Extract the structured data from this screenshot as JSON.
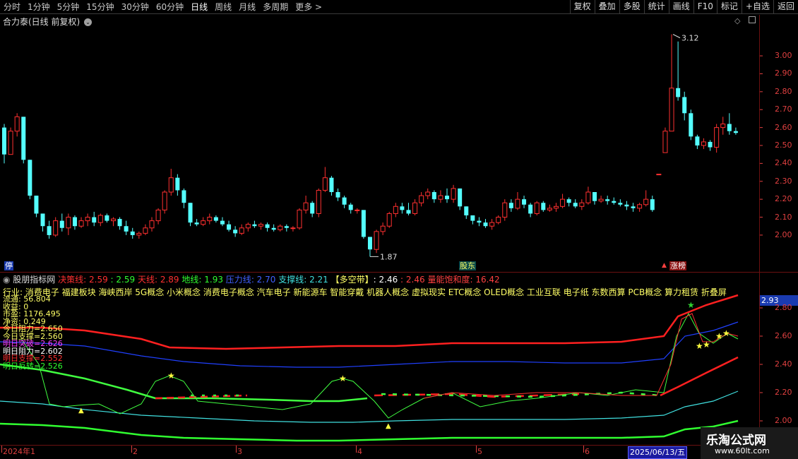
{
  "toolbar": {
    "periods": [
      "分时",
      "1分钟",
      "5分钟",
      "15分钟",
      "30分钟",
      "60分钟",
      "日线",
      "周线",
      "月线",
      "多周期",
      "更多 >"
    ],
    "active_period": "日线",
    "buttons": [
      "复权",
      "叠加",
      "多股",
      "统计",
      "画线",
      "F10",
      "标记",
      "+自选",
      "返回"
    ]
  },
  "stock": {
    "title": "合力泰(日线 前复权)",
    "high_label": "3.12",
    "low_label": "1.87",
    "y_labels": [
      "3.00",
      "2.90",
      "2.80",
      "2.70",
      "2.60",
      "2.50",
      "2.40",
      "2.30",
      "2.20",
      "2.10",
      "2.00"
    ],
    "tags": [
      "停",
      "股东",
      "涨榜"
    ]
  },
  "indicator": {
    "name": "股朋指标网",
    "lines": [
      {
        "label": "决策线",
        "value": "2.59",
        "extra": "2.59",
        "color": "#ff3030"
      },
      {
        "label": "天线",
        "value": "2.89",
        "color": "#ff3030"
      },
      {
        "label": "地线",
        "value": "1.93",
        "color": "#30ff30"
      },
      {
        "label": "压力线",
        "value": "2.70",
        "color": "#4060ff"
      },
      {
        "label": "支撑线",
        "value": "2.21",
        "color": "#40e0e0"
      }
    ],
    "band_label": "【多空带】",
    "band_values": [
      "2.46",
      "2.46"
    ],
    "volume_label": "量能饱和度",
    "volume_value": "16.42",
    "industry": "行业: 消费电子  福建板块  海峡西岸 5G概念 小米概念 消费电子概念 汽车电子 新能源车 智能穿戴 机器人概念 虚拟现实 ETC概念 OLED概念 工业互联 电子纸 东数西算 PCB概念 算力租赁 折叠屏",
    "info": [
      {
        "text": "流通: 56.804",
        "color": "#ffff66"
      },
      {
        "text": "收益: 0",
        "color": "#ffff66"
      },
      {
        "text": "市盈: 1176.495",
        "color": "#ffff66"
      },
      {
        "text": "净资: 0.249",
        "color": "#ffff66"
      },
      {
        "text": "今日阻力=2.650",
        "color": "#ffff66"
      },
      {
        "text": "今日支撑=2.560",
        "color": "#ffff66"
      },
      {
        "text": "明日突破=2.626",
        "color": "#ff40ff"
      },
      {
        "text": "明日阻力=2.602",
        "color": "#ffffff"
      },
      {
        "text": "明日支撑=2.552",
        "color": "#ff3030"
      },
      {
        "text": "明日反转=2.526",
        "color": "#30ff30"
      }
    ],
    "current_value": "2.93",
    "y_labels": [
      "2.80",
      "2.60",
      "2.40",
      "2.20",
      "2.00"
    ]
  },
  "date_axis": {
    "ticks": [
      "2024年1",
      "2",
      "3",
      "4",
      "5",
      "6"
    ],
    "selected_date": "2025/06/13/五"
  },
  "watermark": {
    "title": "乐淘公式网",
    "url": "www.60lt.com"
  },
  "chart_data": {
    "type": "candlestick",
    "up_color": "#ff3030",
    "down_color": "#54ffff",
    "ylim": [
      1.85,
      3.15
    ],
    "candles": [
      [
        2.6,
        2.62,
        2.4,
        2.45
      ],
      [
        2.45,
        2.6,
        2.45,
        2.58
      ],
      [
        2.58,
        2.68,
        2.55,
        2.66
      ],
      [
        2.66,
        2.66,
        2.4,
        2.42
      ],
      [
        2.42,
        2.42,
        2.2,
        2.22
      ],
      [
        2.22,
        2.22,
        2.1,
        2.12
      ],
      [
        2.12,
        2.12,
        2.02,
        2.05
      ],
      [
        2.05,
        2.08,
        1.98,
        2.0
      ],
      [
        2.0,
        2.1,
        1.99,
        2.08
      ],
      [
        2.08,
        2.12,
        2.02,
        2.04
      ],
      [
        2.04,
        2.12,
        2.0,
        2.1
      ],
      [
        2.1,
        2.11,
        2.03,
        2.05
      ],
      [
        2.05,
        2.1,
        2.04,
        2.08
      ],
      [
        2.08,
        2.12,
        2.05,
        2.1
      ],
      [
        2.1,
        2.13,
        2.05,
        2.07
      ],
      [
        2.07,
        2.12,
        2.05,
        2.11
      ],
      [
        2.11,
        2.12,
        2.07,
        2.08
      ],
      [
        2.08,
        2.1,
        2.05,
        2.09
      ],
      [
        2.09,
        2.1,
        2.03,
        2.05
      ],
      [
        2.05,
        2.08,
        2.0,
        2.02
      ],
      [
        2.02,
        2.04,
        1.98,
        2.0
      ],
      [
        2.0,
        2.02,
        1.98,
        2.01
      ],
      [
        2.01,
        2.06,
        2.0,
        2.04
      ],
      [
        2.04,
        2.1,
        2.02,
        2.08
      ],
      [
        2.08,
        2.15,
        2.06,
        2.14
      ],
      [
        2.14,
        2.25,
        2.12,
        2.24
      ],
      [
        2.24,
        2.37,
        2.22,
        2.32
      ],
      [
        2.32,
        2.34,
        2.22,
        2.25
      ],
      [
        2.25,
        2.26,
        2.15,
        2.18
      ],
      [
        2.18,
        2.18,
        2.05,
        2.07
      ],
      [
        2.07,
        2.09,
        2.05,
        2.06
      ],
      [
        2.06,
        2.1,
        2.05,
        2.08
      ],
      [
        2.08,
        2.12,
        2.06,
        2.1
      ],
      [
        2.1,
        2.11,
        2.07,
        2.08
      ],
      [
        2.08,
        2.1,
        2.05,
        2.06
      ],
      [
        2.06,
        2.08,
        2.02,
        2.03
      ],
      [
        2.03,
        2.05,
        1.99,
        2.01
      ],
      [
        2.01,
        2.06,
        2.0,
        2.04
      ],
      [
        2.04,
        2.07,
        2.02,
        2.06
      ],
      [
        2.06,
        2.08,
        2.04,
        2.05
      ],
      [
        2.05,
        2.07,
        2.03,
        2.06
      ],
      [
        2.06,
        2.07,
        2.02,
        2.04
      ],
      [
        2.04,
        2.06,
        2.02,
        2.03
      ],
      [
        2.03,
        2.06,
        2.02,
        2.05
      ],
      [
        2.05,
        2.06,
        2.02,
        2.04
      ],
      [
        2.04,
        2.05,
        2.02,
        2.04
      ],
      [
        2.04,
        2.15,
        2.03,
        2.14
      ],
      [
        2.14,
        2.22,
        2.12,
        2.18
      ],
      [
        2.18,
        2.19,
        2.1,
        2.12
      ],
      [
        2.12,
        2.26,
        2.1,
        2.25
      ],
      [
        2.25,
        2.38,
        2.24,
        2.32
      ],
      [
        2.32,
        2.33,
        2.22,
        2.24
      ],
      [
        2.24,
        2.26,
        2.19,
        2.21
      ],
      [
        2.21,
        2.22,
        2.15,
        2.17
      ],
      [
        2.17,
        2.18,
        2.12,
        2.14
      ],
      [
        2.14,
        2.15,
        2.12,
        2.14
      ],
      [
        2.14,
        2.14,
        1.98,
        1.99
      ],
      [
        1.99,
        1.99,
        1.88,
        1.92
      ],
      [
        1.92,
        2.03,
        1.9,
        2.02
      ],
      [
        2.02,
        2.07,
        2.0,
        2.05
      ],
      [
        2.05,
        2.13,
        2.04,
        2.12
      ],
      [
        2.12,
        2.18,
        2.1,
        2.16
      ],
      [
        2.16,
        2.18,
        2.12,
        2.14
      ],
      [
        2.14,
        2.18,
        2.11,
        2.12
      ],
      [
        2.12,
        2.2,
        2.11,
        2.18
      ],
      [
        2.18,
        2.24,
        2.16,
        2.22
      ],
      [
        2.22,
        2.26,
        2.2,
        2.24
      ],
      [
        2.24,
        2.25,
        2.18,
        2.2
      ],
      [
        2.2,
        2.25,
        2.18,
        2.22
      ],
      [
        2.22,
        2.26,
        2.18,
        2.2
      ],
      [
        2.2,
        2.28,
        2.18,
        2.26
      ],
      [
        2.26,
        2.26,
        2.14,
        2.16
      ],
      [
        2.16,
        2.16,
        2.09,
        2.11
      ],
      [
        2.11,
        2.11,
        2.06,
        2.08
      ],
      [
        2.08,
        2.1,
        2.05,
        2.07
      ],
      [
        2.07,
        2.09,
        2.04,
        2.05
      ],
      [
        2.05,
        2.09,
        2.03,
        2.07
      ],
      [
        2.07,
        2.11,
        2.06,
        2.1
      ],
      [
        2.1,
        2.2,
        2.08,
        2.18
      ],
      [
        2.18,
        2.2,
        2.13,
        2.15
      ],
      [
        2.15,
        2.24,
        2.14,
        2.2
      ],
      [
        2.2,
        2.22,
        2.15,
        2.17
      ],
      [
        2.17,
        2.18,
        2.1,
        2.12
      ],
      [
        2.12,
        2.19,
        2.11,
        2.18
      ],
      [
        2.18,
        2.19,
        2.13,
        2.14
      ],
      [
        2.14,
        2.17,
        2.13,
        2.15
      ],
      [
        2.15,
        2.18,
        2.13,
        2.16
      ],
      [
        2.16,
        2.23,
        2.15,
        2.2
      ],
      [
        2.2,
        2.21,
        2.16,
        2.18
      ],
      [
        2.18,
        2.2,
        2.15,
        2.16
      ],
      [
        2.16,
        2.2,
        2.14,
        2.18
      ],
      [
        2.18,
        2.27,
        2.17,
        2.24
      ],
      [
        2.24,
        2.24,
        2.17,
        2.19
      ],
      [
        2.19,
        2.22,
        2.18,
        2.2
      ],
      [
        2.2,
        2.22,
        2.17,
        2.19
      ],
      [
        2.19,
        2.21,
        2.17,
        2.18
      ],
      [
        2.18,
        2.2,
        2.16,
        2.17
      ],
      [
        2.17,
        2.19,
        2.14,
        2.16
      ],
      [
        2.16,
        2.18,
        2.13,
        2.15
      ],
      [
        2.15,
        2.18,
        2.13,
        2.17
      ],
      [
        2.17,
        2.25,
        2.16,
        2.2
      ],
      [
        2.2,
        2.22,
        2.13,
        2.14
      ],
      [
        2.34,
        2.34,
        2.34,
        2.34
      ],
      [
        2.46,
        2.6,
        2.46,
        2.58
      ],
      [
        2.58,
        3.12,
        2.58,
        2.82
      ],
      [
        2.82,
        3.08,
        2.75,
        2.77
      ],
      [
        2.77,
        2.8,
        2.64,
        2.68
      ],
      [
        2.68,
        2.7,
        2.53,
        2.55
      ],
      [
        2.55,
        2.56,
        2.48,
        2.5
      ],
      [
        2.5,
        2.54,
        2.48,
        2.52
      ],
      [
        2.52,
        2.53,
        2.47,
        2.49
      ],
      [
        2.49,
        2.62,
        2.46,
        2.6
      ],
      [
        2.6,
        2.66,
        2.56,
        2.62
      ],
      [
        2.62,
        2.68,
        2.56,
        2.58
      ],
      [
        2.58,
        2.6,
        2.56,
        2.57
      ]
    ]
  }
}
